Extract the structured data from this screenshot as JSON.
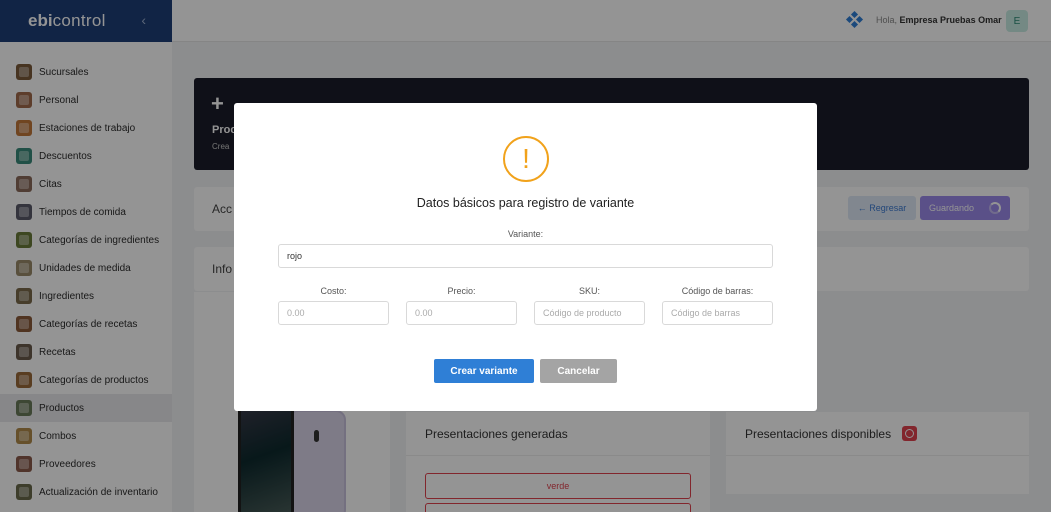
{
  "brand": {
    "name_bold": "ebi",
    "name_light": "control",
    "collapse_glyph": "‹"
  },
  "sidebar": {
    "items": [
      {
        "label": "Sucursales",
        "icon": "branch-icon",
        "color": "#7a5a3a"
      },
      {
        "label": "Personal",
        "icon": "staff-icon",
        "color": "#a06a4a"
      },
      {
        "label": "Estaciones de trabajo",
        "icon": "workstation-icon",
        "color": "#c2773a"
      },
      {
        "label": "Descuentos",
        "icon": "discount-icon",
        "color": "#3a8a7a"
      },
      {
        "label": "Citas",
        "icon": "calendar-icon",
        "color": "#8a6a5a"
      },
      {
        "label": "Tiempos de comida",
        "icon": "meal-time-icon",
        "color": "#5a5a6a"
      },
      {
        "label": "Categorías de ingredientes",
        "icon": "ingredient-category-icon",
        "color": "#6a7a3a"
      },
      {
        "label": "Unidades de medida",
        "icon": "measure-unit-icon",
        "color": "#9a8a6a"
      },
      {
        "label": "Ingredientes",
        "icon": "ingredient-icon",
        "color": "#7a6a4a"
      },
      {
        "label": "Categorías de recetas",
        "icon": "recipe-category-icon",
        "color": "#8a5a3a"
      },
      {
        "label": "Recetas",
        "icon": "recipe-icon",
        "color": "#6a5a4a"
      },
      {
        "label": "Categorías de productos",
        "icon": "product-category-icon",
        "color": "#9a6a3a"
      },
      {
        "label": "Productos",
        "icon": "product-icon",
        "color": "#6a7a5a"
      },
      {
        "label": "Combos",
        "icon": "combo-icon",
        "color": "#b08a4a"
      },
      {
        "label": "Proveedores",
        "icon": "supplier-icon",
        "color": "#8a5a4a"
      },
      {
        "label": "Actualización de inventario",
        "icon": "inventory-icon",
        "color": "#6a6a4a"
      }
    ],
    "active_index": 12
  },
  "topbar": {
    "greeting": "Hola,",
    "user_name": "Empresa Pruebas Omar",
    "avatar_letter": "E"
  },
  "hero": {
    "plus": "+",
    "title": "Proc",
    "subtitle": "Crea"
  },
  "actions": {
    "label": "Acc",
    "back_label": "← Regresar",
    "saving_label": "Guardando"
  },
  "info": {
    "label": "Info"
  },
  "generated": {
    "title": "Presentaciones generadas",
    "chips": [
      "verde",
      ""
    ]
  },
  "available": {
    "title": "Presentaciones disponibles"
  },
  "modal": {
    "warning_glyph": "!",
    "title": "Datos básicos para registro de variante",
    "variant_label": "Variante:",
    "variant_value": "rojo",
    "cost_label": "Costo:",
    "cost_placeholder": "0.00",
    "price_label": "Precio:",
    "price_placeholder": "0.00",
    "sku_label": "SKU:",
    "sku_placeholder": "Código de producto",
    "barcode_label": "Código de barras:",
    "barcode_placeholder": "Código de barras",
    "create_label": "Crear variante",
    "cancel_label": "Cancelar"
  },
  "colors": {
    "accent": "#2f7fd6",
    "warning": "#f1a21b",
    "danger": "#e0424f",
    "brand_bg": "#1e3f78"
  }
}
